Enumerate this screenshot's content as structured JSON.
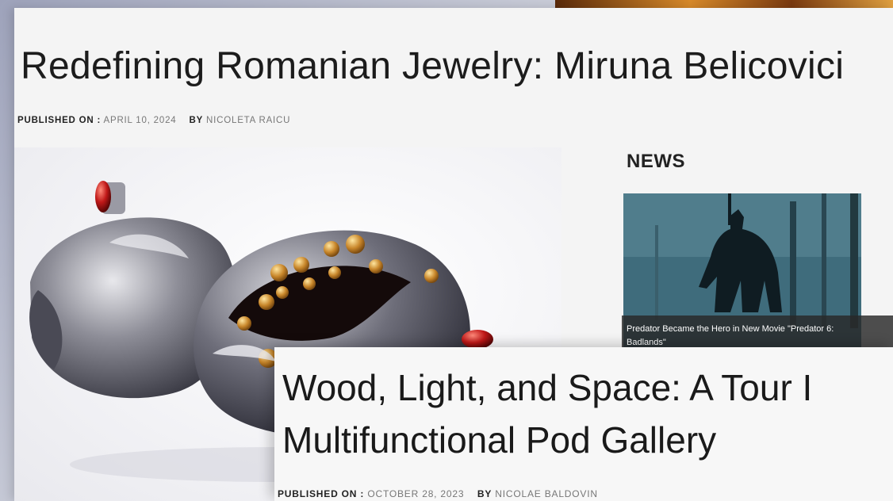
{
  "article_back": {
    "title": "Redefining Romanian Jewelry: Miruna Belicovici",
    "published_label": "PUBLISHED ON :",
    "published_date": "APRIL 10, 2024",
    "by_label": "BY",
    "author": "NICOLETA RAICU"
  },
  "sidebar": {
    "news_heading": "NEWS",
    "featured": {
      "caption": "Predator Became the Hero in New Movie \"Predator 6: Badlands\""
    }
  },
  "article_front": {
    "title_line1": "Wood, Light, and Space: A Tour I",
    "title_line2": "Multifunctional Pod Gallery",
    "published_label": "PUBLISHED ON :",
    "published_date": "OCTOBER 28, 2023",
    "by_label": "BY",
    "author": "NICOLAE BALDOVIN"
  },
  "colors": {
    "page_bg": "#f4f4f4",
    "title_text": "#1c1c1c",
    "meta_value": "#777777",
    "caption_overlay": "#282828"
  }
}
